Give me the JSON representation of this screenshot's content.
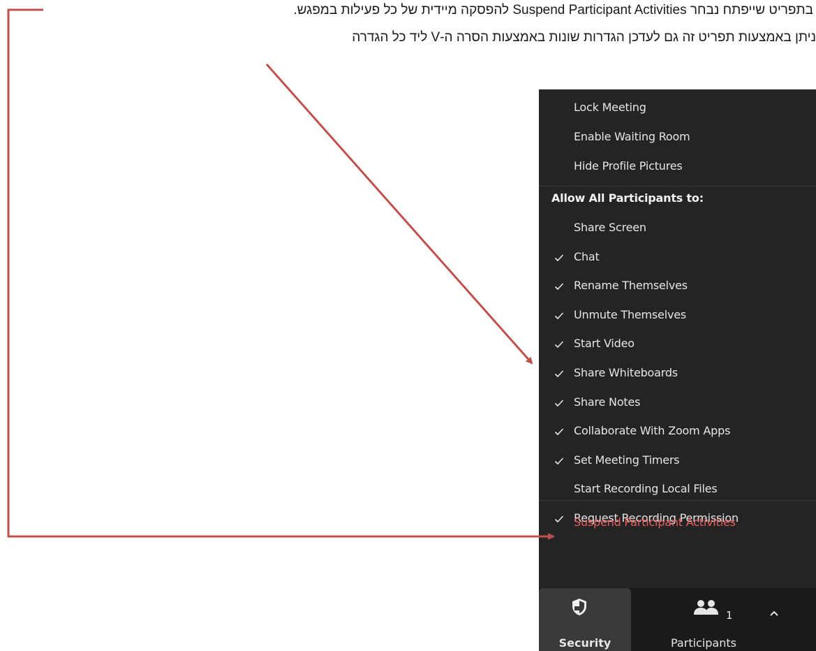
{
  "annotation": {
    "line1": "בתפריט שייפתח נבחר Suspend Participant Activities להפסקה מיידית של כל פעילות במפגש.",
    "line2": "ניתן באמצעות תפריט זה גם לעדכן הגדרות שונות באמצעות הסרה ה-V ליד כל הגדרה"
  },
  "menu": {
    "top_items": [
      {
        "label": "Lock Meeting",
        "checked": false
      },
      {
        "label": "Enable Waiting Room",
        "checked": false
      },
      {
        "label": "Hide Profile Pictures",
        "checked": false
      }
    ],
    "section_header": "Allow All Participants to:",
    "participant_items": [
      {
        "label": "Share Screen",
        "checked": false
      },
      {
        "label": "Chat",
        "checked": true
      },
      {
        "label": "Rename Themselves",
        "checked": true
      },
      {
        "label": "Unmute Themselves",
        "checked": true
      },
      {
        "label": "Start Video",
        "checked": true
      },
      {
        "label": "Share Whiteboards",
        "checked": true
      },
      {
        "label": "Share Notes",
        "checked": true
      },
      {
        "label": "Collaborate With Zoom Apps",
        "checked": true
      },
      {
        "label": "Set Meeting Timers",
        "checked": true
      },
      {
        "label": "Start Recording Local Files",
        "checked": false
      },
      {
        "label": "Request Recording Permission",
        "checked": true
      }
    ],
    "suspend_label": "Suspend Participant Activities"
  },
  "toolbar": {
    "security_label": "Security",
    "security_icon": "shield-icon",
    "participants_label": "Participants",
    "participants_icon": "people-icon",
    "participants_count": "1",
    "more_icon": "chevron-up-icon"
  },
  "colors": {
    "menu_bg": "#242424",
    "danger": "#e85d5d",
    "arrow": "#c0504d"
  }
}
